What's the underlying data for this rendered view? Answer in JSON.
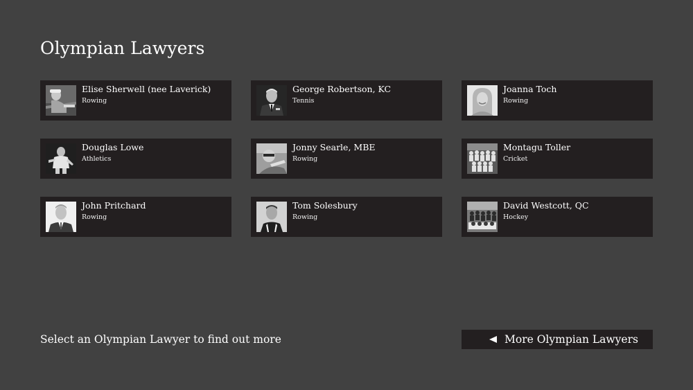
{
  "page": {
    "title": "Olympian Lawyers"
  },
  "lawyers": [
    {
      "name": "Elise Sherwell (nee Laverick)",
      "sport": "Rowing"
    },
    {
      "name": "George Robertson, KC",
      "sport": "Tennis"
    },
    {
      "name": "Joanna Toch",
      "sport": "Rowing"
    },
    {
      "name": "Douglas Lowe",
      "sport": "Athletics"
    },
    {
      "name": "Jonny Searle, MBE",
      "sport": "Rowing"
    },
    {
      "name": "Montagu Toller",
      "sport": "Cricket"
    },
    {
      "name": "John Pritchard",
      "sport": "Rowing"
    },
    {
      "name": "Tom Solesbury",
      "sport": "Rowing"
    },
    {
      "name": "David Westcott, QC",
      "sport": "Hockey"
    }
  ],
  "footer": {
    "instruction": "Select an Olympian Lawyer to find out more",
    "more_button_label": "More Olympian Lawyers",
    "more_button_icon": "left-triangle-icon"
  },
  "colors": {
    "background": "#414141",
    "card_background": "#231f20",
    "text": "#ffffff"
  }
}
